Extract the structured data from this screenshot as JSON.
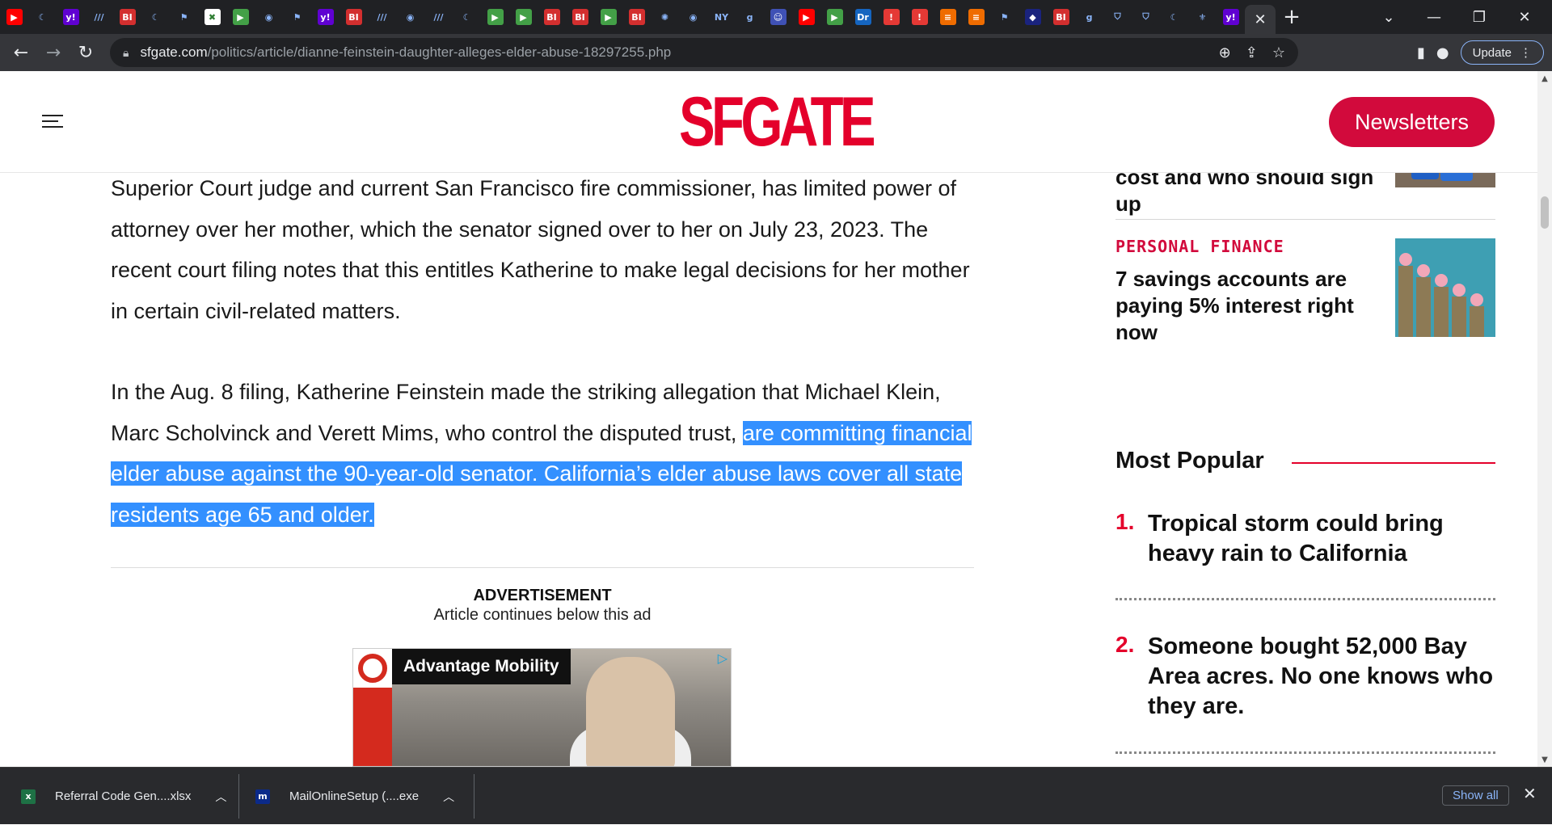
{
  "browser": {
    "tabs": [
      {
        "icon": "youtube-icon",
        "color": "#ff0000",
        "glyph": "▶"
      },
      {
        "icon": "shield-icon",
        "color": "#202124",
        "glyph": "☾"
      },
      {
        "icon": "yahoo-icon",
        "color": "#6001d2",
        "glyph": "y!"
      },
      {
        "icon": "newspaper-icon",
        "color": "#202124",
        "glyph": "///"
      },
      {
        "icon": "business-insider-icon",
        "color": "#d32f2f",
        "glyph": "BI"
      },
      {
        "icon": "shield-icon",
        "color": "#202124",
        "glyph": "☾"
      },
      {
        "icon": "flag-icon",
        "color": "#202124",
        "glyph": "⚑"
      },
      {
        "icon": "puzzle-icon",
        "color": "#ffffff",
        "glyph": "✖"
      },
      {
        "icon": "play-icon",
        "color": "#43a047",
        "glyph": "▶"
      },
      {
        "icon": "globe-icon",
        "color": "#202124",
        "glyph": "◉"
      },
      {
        "icon": "flag-icon",
        "color": "#202124",
        "glyph": "⚑"
      },
      {
        "icon": "yahoo-icon",
        "color": "#6001d2",
        "glyph": "y!"
      },
      {
        "icon": "business-insider-icon",
        "color": "#d32f2f",
        "glyph": "BI"
      },
      {
        "icon": "newspaper-icon",
        "color": "#202124",
        "glyph": "///"
      },
      {
        "icon": "globe-icon",
        "color": "#202124",
        "glyph": "◉"
      },
      {
        "icon": "newspaper-icon",
        "color": "#202124",
        "glyph": "///"
      },
      {
        "icon": "shield-icon",
        "color": "#202124",
        "glyph": "☾"
      },
      {
        "icon": "play-icon",
        "color": "#43a047",
        "glyph": "▶"
      },
      {
        "icon": "play-icon",
        "color": "#43a047",
        "glyph": "▶"
      },
      {
        "icon": "business-insider-icon",
        "color": "#d32f2f",
        "glyph": "BI"
      },
      {
        "icon": "business-insider-icon",
        "color": "#d32f2f",
        "glyph": "BI"
      },
      {
        "icon": "play-icon",
        "color": "#43a047",
        "glyph": "▶"
      },
      {
        "icon": "business-insider-icon",
        "color": "#d32f2f",
        "glyph": "BI"
      },
      {
        "icon": "burst-icon",
        "color": "#202124",
        "glyph": "✺"
      },
      {
        "icon": "globe-icon",
        "color": "#202124",
        "glyph": "◉"
      },
      {
        "icon": "news-icon",
        "color": "#202124",
        "glyph": "NY"
      },
      {
        "icon": "g-icon",
        "color": "#202124",
        "glyph": "g"
      },
      {
        "icon": "portrait-icon",
        "color": "#3f51b5",
        "glyph": "☺"
      },
      {
        "icon": "youtube-icon",
        "color": "#ff0000",
        "glyph": "▶"
      },
      {
        "icon": "play-icon",
        "color": "#43a047",
        "glyph": "▶"
      },
      {
        "icon": "dr-icon",
        "color": "#1565c0",
        "glyph": "Dr"
      },
      {
        "icon": "alert-icon",
        "color": "#e53935",
        "glyph": "!"
      },
      {
        "icon": "alert-icon",
        "color": "#e53935",
        "glyph": "!"
      },
      {
        "icon": "bookmark-icon",
        "color": "#ef6c00",
        "glyph": "≡"
      },
      {
        "icon": "bookmark-icon",
        "color": "#ef6c00",
        "glyph": "≡"
      },
      {
        "icon": "flag-icon",
        "color": "#202124",
        "glyph": "⚑"
      },
      {
        "icon": "cube-icon",
        "color": "#1a237e",
        "glyph": "◆"
      },
      {
        "icon": "business-insider-icon",
        "color": "#d32f2f",
        "glyph": "BI"
      },
      {
        "icon": "g-icon",
        "color": "#202124",
        "glyph": "g"
      },
      {
        "icon": "shield-icon",
        "color": "#202124",
        "glyph": "⛉"
      },
      {
        "icon": "shield-icon",
        "color": "#202124",
        "glyph": "⛉"
      },
      {
        "icon": "shield-icon",
        "color": "#202124",
        "glyph": "☾"
      },
      {
        "icon": "crest-icon",
        "color": "#202124",
        "glyph": "⚜"
      },
      {
        "icon": "yahoo-icon",
        "color": "#6001d2",
        "glyph": "y!"
      }
    ],
    "url_host": "sfgate.com",
    "url_path": "/politics/article/dianne-feinstein-daughter-alleges-elder-abuse-18297255.php",
    "update_label": "Update"
  },
  "site": {
    "logo": "SFGATE",
    "newsletters_label": "Newsletters"
  },
  "article": {
    "para1": "Superior Court judge and current San Francisco fire commissioner, has limited power of attorney over her mother, which the senator signed over to her on July 23, 2023. The recent court filing notes that this entitles Katherine to make legal decisions for her mother in certain civil-related matters.",
    "para2_plain": "In the Aug. 8 filing, Katherine Feinstein made the striking allegation that Michael Klein, Marc Scholvinck and Verett Mims, who control the disputed trust, ",
    "para2_highlight": "are committing financial elder abuse against the 90-year-old senator. California’s elder abuse laws cover all state residents age 65 and older.",
    "ad_label": "ADVERTISEMENT",
    "ad_sub": "Article continues below this ad",
    "ad_title": "Advantage Mobility"
  },
  "sidebar": {
    "story1_title": "Walmart Plus: Benefits, cost and who should sign up",
    "story2_kicker": "PERSONAL FINANCE",
    "story2_title": "7 savings accounts are paying 5% interest right now",
    "most_popular_heading": "Most Popular",
    "popular": [
      {
        "num": "1.",
        "title": "Tropical storm could bring heavy rain to California"
      },
      {
        "num": "2.",
        "title": "Someone bought 52,000 Bay Area acres. No one knows who they are."
      }
    ]
  },
  "downloads": {
    "item1": "Referral Code Gen....xlsx",
    "item2": "MailOnlineSetup (....exe",
    "show_all": "Show all"
  }
}
